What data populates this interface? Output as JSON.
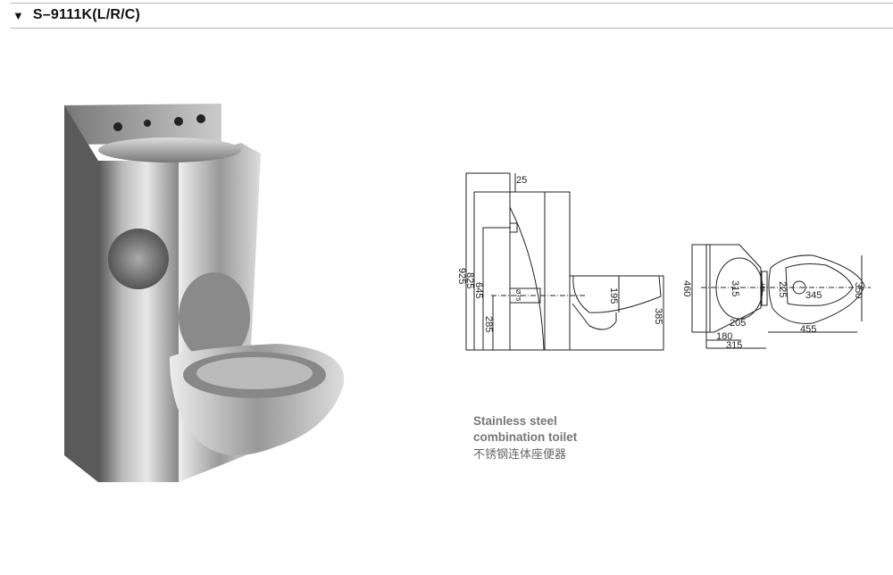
{
  "header": {
    "toggle_icon": "triangle-down-icon",
    "title": "S–9111K(L/R/C)"
  },
  "side_view": {
    "dims": [
      "25",
      "925",
      "825",
      "645",
      "285",
      "Ø75",
      "195",
      "385"
    ]
  },
  "plan_view": {
    "dims": [
      "460",
      "315",
      "185",
      "205",
      "180",
      "315",
      "225",
      "345",
      "455",
      "350"
    ]
  },
  "caption": {
    "line1": "Stainless steel",
    "line2": "combination toilet",
    "chinese": "不锈钢连体座便器"
  }
}
